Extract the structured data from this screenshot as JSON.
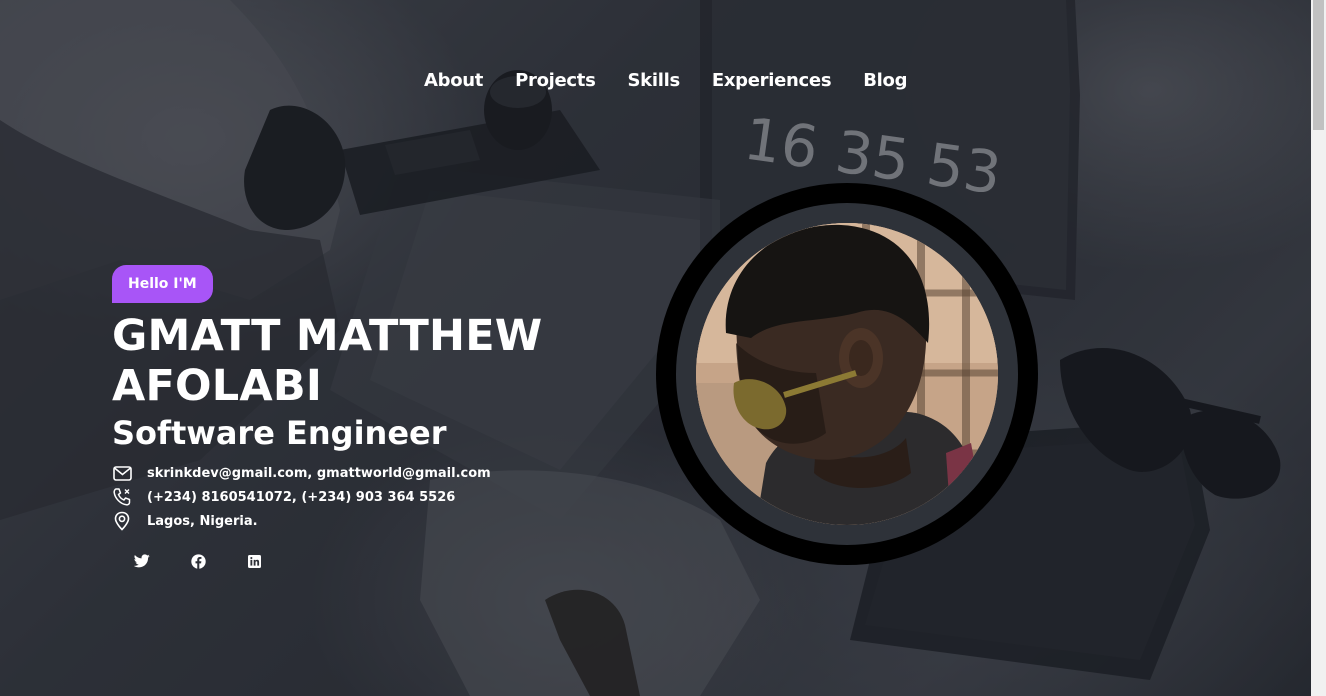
{
  "nav": {
    "items": [
      {
        "label": "About"
      },
      {
        "label": "Projects"
      },
      {
        "label": "Skills"
      },
      {
        "label": "Experiences"
      },
      {
        "label": "Blog"
      }
    ]
  },
  "hero": {
    "badge": "Hello I'M",
    "name": "GMATT MATTHEW AFOLABI",
    "role": "Software Engineer",
    "contacts": {
      "email": "skrinkdev@gmail.com, gmattworld@gmail.com",
      "phone": "(+234) 8160541072, (+234) 903 364 5526",
      "location": "Lagos, Nigeria."
    },
    "socials": [
      {
        "icon": "twitter-icon"
      },
      {
        "icon": "facebook-icon"
      },
      {
        "icon": "linkedin-icon"
      }
    ],
    "background_clock_text": "16 35 53"
  },
  "colors": {
    "accent": "#a855f7",
    "text": "#ffffff",
    "overlay": "#181b22",
    "avatar_ring": "#000000"
  }
}
